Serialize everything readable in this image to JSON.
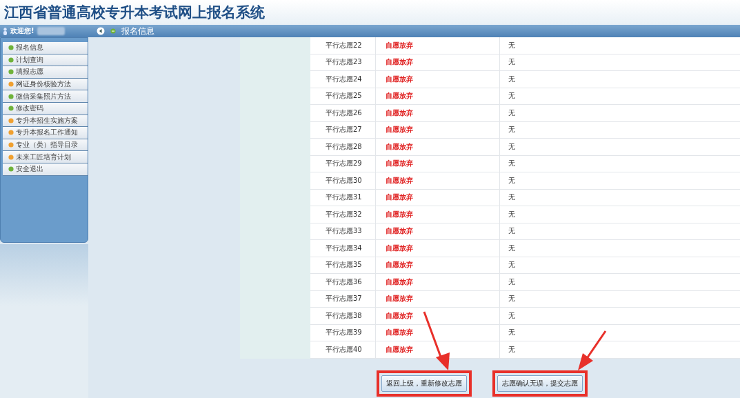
{
  "title": "江西省普通高校专升本考试网上报名系统",
  "header": {
    "welcome": "欢迎您!",
    "breadcrumb": "报名信息"
  },
  "sidebar": {
    "items": [
      {
        "label": "报名信息",
        "color": "#6fb23a"
      },
      {
        "label": "计划查询",
        "color": "#6fb23a"
      },
      {
        "label": "填报志愿",
        "color": "#6fb23a"
      },
      {
        "label": "网证身份核验方法",
        "color": "#f0a030"
      },
      {
        "label": "微信采集照片方法",
        "color": "#6fb23a"
      },
      {
        "label": "修改密码",
        "color": "#6fb23a"
      },
      {
        "label": "专升本招生实施方案",
        "color": "#f0a030"
      },
      {
        "label": "专升本报名工作通知",
        "color": "#f0a030"
      },
      {
        "label": "专业（类）指导目录",
        "color": "#f0a030"
      },
      {
        "label": "未来工匠培育计划",
        "color": "#f0a030"
      },
      {
        "label": "安全退出",
        "color": "#6fb23a"
      }
    ]
  },
  "table": {
    "rows": [
      {
        "choice": "平行志愿22",
        "status": "自愿放弃",
        "note": "无"
      },
      {
        "choice": "平行志愿23",
        "status": "自愿放弃",
        "note": "无"
      },
      {
        "choice": "平行志愿24",
        "status": "自愿放弃",
        "note": "无"
      },
      {
        "choice": "平行志愿25",
        "status": "自愿放弃",
        "note": "无"
      },
      {
        "choice": "平行志愿26",
        "status": "自愿放弃",
        "note": "无"
      },
      {
        "choice": "平行志愿27",
        "status": "自愿放弃",
        "note": "无"
      },
      {
        "choice": "平行志愿28",
        "status": "自愿放弃",
        "note": "无"
      },
      {
        "choice": "平行志愿29",
        "status": "自愿放弃",
        "note": "无"
      },
      {
        "choice": "平行志愿30",
        "status": "自愿放弃",
        "note": "无"
      },
      {
        "choice": "平行志愿31",
        "status": "自愿放弃",
        "note": "无"
      },
      {
        "choice": "平行志愿32",
        "status": "自愿放弃",
        "note": "无"
      },
      {
        "choice": "平行志愿33",
        "status": "自愿放弃",
        "note": "无"
      },
      {
        "choice": "平行志愿34",
        "status": "自愿放弃",
        "note": "无"
      },
      {
        "choice": "平行志愿35",
        "status": "自愿放弃",
        "note": "无"
      },
      {
        "choice": "平行志愿36",
        "status": "自愿放弃",
        "note": "无"
      },
      {
        "choice": "平行志愿37",
        "status": "自愿放弃",
        "note": "无"
      },
      {
        "choice": "平行志愿38",
        "status": "自愿放弃",
        "note": "无"
      },
      {
        "choice": "平行志愿39",
        "status": "自愿放弃",
        "note": "无"
      },
      {
        "choice": "平行志愿40",
        "status": "自愿放弃",
        "note": "无"
      }
    ]
  },
  "buttons": [
    {
      "label": "返回上级，重新修改志愿",
      "highlighted": true
    },
    {
      "label": "志愿确认无误，提交志愿",
      "highlighted": true
    }
  ]
}
